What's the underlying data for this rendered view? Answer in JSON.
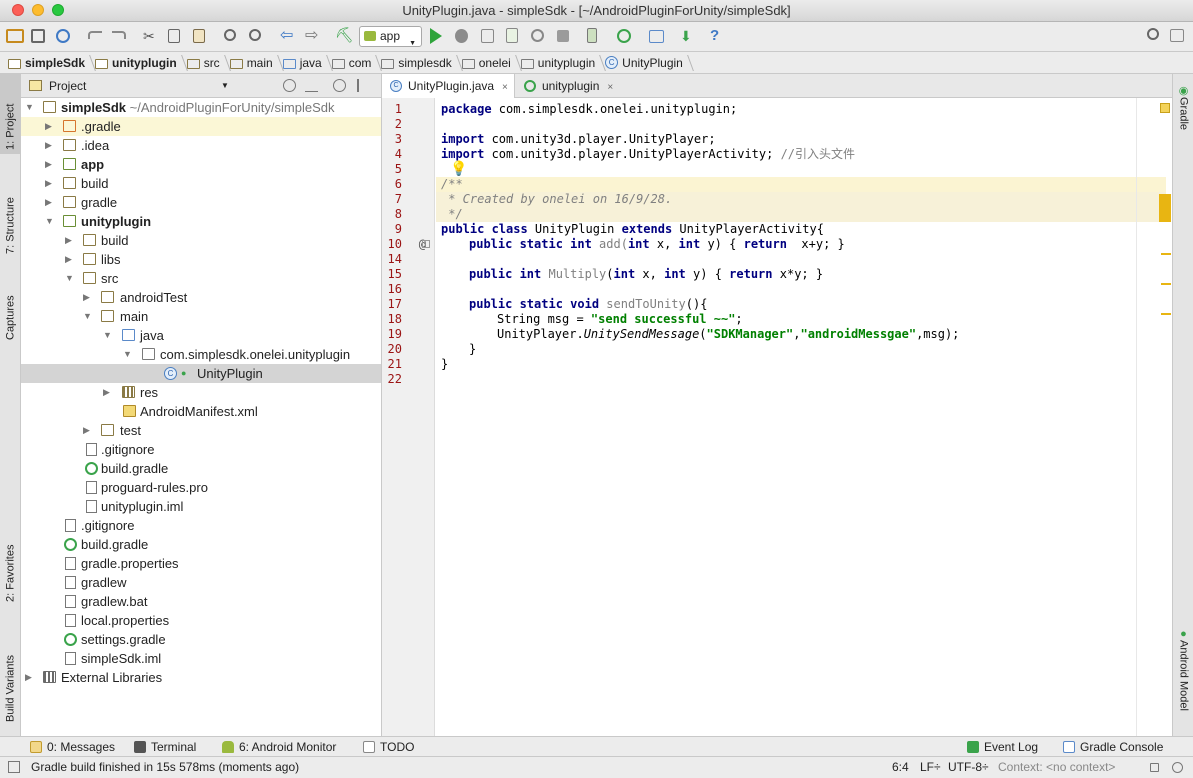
{
  "window": {
    "title": "UnityPlugin.java - simpleSdk - [~/AndroidPluginForUnity/simpleSdk]"
  },
  "toolbar": {
    "run_config": "app"
  },
  "breadcrumbs": [
    "simpleSdk",
    "unityplugin",
    "src",
    "main",
    "java",
    "com",
    "simplesdk",
    "onelei",
    "unityplugin",
    "UnityPlugin"
  ],
  "left_tabs": {
    "project": "1: Project",
    "structure": "7: Structure",
    "captures": "Captures",
    "favorites": "2: Favorites",
    "build_variants": "Build Variants"
  },
  "right_tabs": {
    "gradle": "Gradle",
    "android_model": "Android Model"
  },
  "project": {
    "header": "Project",
    "tree": [
      {
        "label": "simpleSdk",
        "extra": "~/AndroidPluginForUnity/simpleSdk",
        "bold": true
      },
      {
        "label": ".gradle"
      },
      {
        "label": ".idea"
      },
      {
        "label": "app",
        "bold": true
      },
      {
        "label": "build"
      },
      {
        "label": "gradle"
      },
      {
        "label": "unityplugin",
        "bold": true
      },
      {
        "label": "build"
      },
      {
        "label": "libs"
      },
      {
        "label": "src"
      },
      {
        "label": "androidTest"
      },
      {
        "label": "main"
      },
      {
        "label": "java"
      },
      {
        "label": "com.simplesdk.onelei.unityplugin"
      },
      {
        "label": "UnityPlugin"
      },
      {
        "label": "res"
      },
      {
        "label": "AndroidManifest.xml"
      },
      {
        "label": "test"
      },
      {
        "label": ".gitignore"
      },
      {
        "label": "build.gradle"
      },
      {
        "label": "proguard-rules.pro"
      },
      {
        "label": "unityplugin.iml"
      },
      {
        "label": ".gitignore"
      },
      {
        "label": "build.gradle"
      },
      {
        "label": "gradle.properties"
      },
      {
        "label": "gradlew"
      },
      {
        "label": "gradlew.bat"
      },
      {
        "label": "local.properties"
      },
      {
        "label": "settings.gradle"
      },
      {
        "label": "simpleSdk.iml"
      },
      {
        "label": "External Libraries"
      }
    ]
  },
  "editor": {
    "tabs": [
      {
        "label": "UnityPlugin.java",
        "close": "×"
      },
      {
        "label": "unityplugin",
        "close": "×"
      }
    ],
    "line_numbers": [
      "1",
      "2",
      "3",
      "4",
      "5",
      "6",
      "7",
      "8",
      "9",
      "10",
      "14",
      "15",
      "16",
      "17",
      "18",
      "19",
      "20",
      "21",
      "22"
    ],
    "gutter_marker": "@",
    "code": {
      "l1_kw": "package",
      "l1_rest": " com.simplesdk.onelei.unityplugin;",
      "l3_kw": "import",
      "l3_rest": " com.unity3d.player.UnityPlayer;",
      "l4_kw": "import",
      "l4_rest": " com.unity3d.player.UnityPlayerActivity; ",
      "l4_comment": "//引入头文件",
      "l6": "/**",
      "l7": " * Created by onelei on 16/9/28.",
      "l8": " */",
      "l9_kw1": "public class",
      "l9_mid": " UnityPlugin ",
      "l9_kw2": "extends",
      "l9_rest": " UnityPlayerActivity{",
      "l10_kw": "public static int",
      "l10_name": " add(",
      "l10_kw2": "int",
      "l10_a": " x, ",
      "l10_kw3": "int",
      "l10_b": " y) { ",
      "l10_kw4": "return",
      "l10_rest": "  x+y; }",
      "l15_kw": "public int",
      "l15_name": " Multiply",
      "l15_p": "(",
      "l15_kw2": "int",
      "l15_a": " x, ",
      "l15_kw3": "int",
      "l15_b": " y) { ",
      "l15_kw4": "return",
      "l15_rest": " x*y; }",
      "l17_kw": "public static void",
      "l17_name": " sendToUnity",
      "l17_rest": "(){",
      "l18_a": "String msg = ",
      "l18_str": "\"send successful ~~\"",
      "l18_b": ";",
      "l19_a": "UnityPlayer.",
      "l19_m": "UnitySendMessage",
      "l19_b": "(",
      "l19_s1": "\"SDKManager\"",
      "l19_c": ",",
      "l19_s2": "\"androidMessgae\"",
      "l19_d": ",msg);",
      "l20": "}",
      "l21": "}"
    }
  },
  "bottom_tools": {
    "messages": "0: Messages",
    "terminal": "Terminal",
    "android_monitor": "6: Android Monitor",
    "todo": "TODO",
    "event_log": "Event Log",
    "gradle_console": "Gradle Console"
  },
  "status": {
    "message": "Gradle build finished in 15s 578ms (moments ago)",
    "position": "6:4",
    "line_sep": "LF÷",
    "encoding": "UTF-8÷",
    "context": "Context: <no context>"
  },
  "colors": {
    "keyword": "#000080",
    "string": "#008000",
    "line_number": "#9b1414",
    "selection": "#d4d4d4"
  }
}
